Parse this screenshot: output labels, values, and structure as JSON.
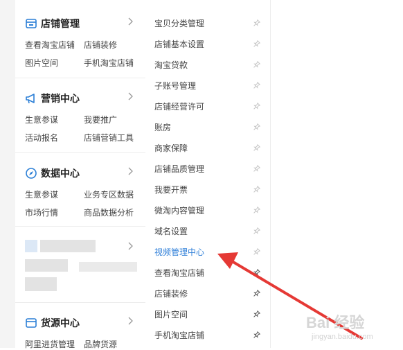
{
  "sections": [
    {
      "title": "店铺管理",
      "icon": "store-icon",
      "links": [
        "查看淘宝店铺",
        "店铺装修",
        "图片空间",
        "手机淘宝店铺"
      ]
    },
    {
      "title": "营销中心",
      "icon": "megaphone-icon",
      "links": [
        "生意参谋",
        "我要推广",
        "活动报名",
        "店铺营销工具"
      ]
    },
    {
      "title": "数据中心",
      "icon": "compass-icon",
      "links": [
        "生意参谋",
        "业务专区数据",
        "市场行情",
        "商品数据分析"
      ]
    },
    {
      "title": "货源中心",
      "icon": "sourcing-icon",
      "links": [
        "阿里进货管理",
        "品牌货源"
      ]
    }
  ],
  "right_menu": [
    {
      "label": "宝贝分类管理",
      "active": false
    },
    {
      "label": "店铺基本设置",
      "active": false
    },
    {
      "label": "淘宝贷款",
      "active": false
    },
    {
      "label": "子账号管理",
      "active": false
    },
    {
      "label": "店铺经营许可",
      "active": false
    },
    {
      "label": "账房",
      "active": false
    },
    {
      "label": "商家保障",
      "active": false
    },
    {
      "label": "店铺品质管理",
      "active": false
    },
    {
      "label": "我要开票",
      "active": false
    },
    {
      "label": "微淘内容管理",
      "active": false
    },
    {
      "label": "域名设置",
      "active": false
    },
    {
      "label": "视频管理中心",
      "active": true
    },
    {
      "label": "查看淘宝店铺",
      "active": false
    },
    {
      "label": "店铺装修",
      "active": false
    },
    {
      "label": "图片空间",
      "active": false
    },
    {
      "label": "手机淘宝店铺",
      "active": false
    }
  ],
  "colors": {
    "accent": "#2f7fd8",
    "arrow": "#e53935",
    "icon_blue": "#2b7fd6"
  },
  "watermark": {
    "logo": "Bai 经验",
    "sub": "jingyan.baidu.com"
  }
}
